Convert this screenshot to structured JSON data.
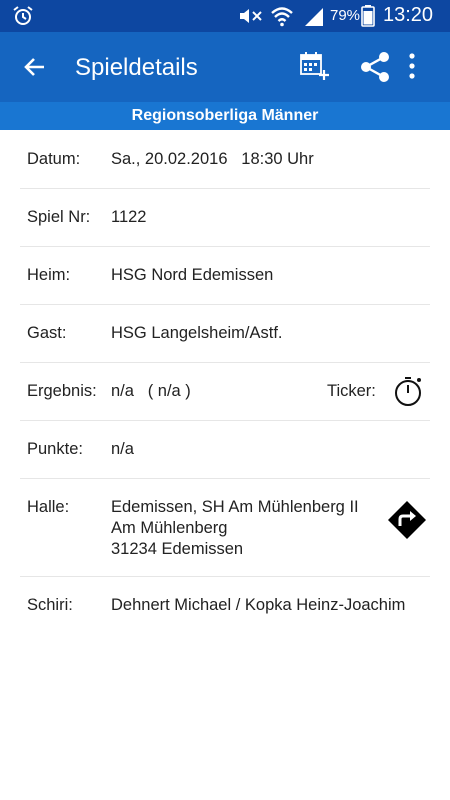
{
  "status_bar": {
    "battery_percent": "79%",
    "time": "13:20",
    "icons": [
      "alarm-icon",
      "mute-icon",
      "wifi-icon",
      "signal-icon",
      "battery-icon"
    ]
  },
  "app_bar": {
    "title": "Spieldetails",
    "icons": [
      "back-arrow-icon",
      "calendar-add-icon",
      "share-icon",
      "more-vert-icon"
    ],
    "background": "#1565c0"
  },
  "league": "Regionsoberliga Männer",
  "details": {
    "datum_label": "Datum:",
    "datum_value": "Sa., 20.02.2016   18:30 Uhr",
    "spielnr_label": "Spiel Nr:",
    "spielnr_value": "1122",
    "heim_label": "Heim:",
    "heim_value": "HSG Nord Edemissen",
    "gast_label": "Gast:",
    "gast_value": "HSG Langelsheim/Astf.",
    "ergebnis_label": "Ergebnis:",
    "ergebnis_value": "n/a   ( n/a )",
    "ticker_label": "Ticker:",
    "punkte_label": "Punkte:",
    "punkte_value": "n/a",
    "halle_label": "Halle:",
    "halle_lines": [
      "Edemissen, SH Am Mühlenberg II",
      "Am Mühlenberg",
      "31234 Edemissen"
    ],
    "schiri_label": "Schiri:",
    "schiri_value": "Dehnert Michael / Kopka Heinz-Joachim"
  }
}
